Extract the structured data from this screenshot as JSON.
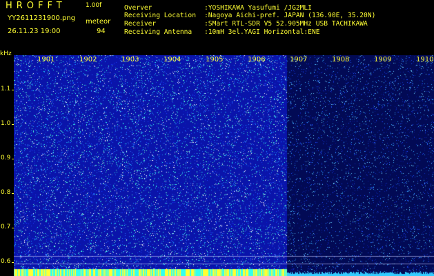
{
  "header": {
    "logo": "HROFFT",
    "version": "1.00f",
    "filename": "YY2611231900.png",
    "datetime": "26.11.23 19:00",
    "meteor_label": "meteor",
    "meteor_count": "94"
  },
  "info": [
    {
      "key": "Overver",
      "value": ":YOSHIKAWA Yasufumi /JG2MLI"
    },
    {
      "key": "Receiving Location",
      "value": ":Nagoya Aichi-pref. JAPAN (136.90E, 35.20N)"
    },
    {
      "key": "Receiver",
      "value": ":SMart RTL-SDR V5 52.905MHz USB TACHIKAWA"
    },
    {
      "key": "Receiving Antenna",
      "value": ":10mH 3el.YAGI Horizontal:ENE"
    }
  ],
  "axis": {
    "unit": "kHz",
    "freq_ticks": [
      "1.1",
      "1.0",
      "0.9",
      "0.8",
      "0.7",
      "0.6"
    ],
    "freq_values": [
      1.1,
      1.0,
      0.9,
      0.8,
      0.7,
      0.6
    ],
    "time_ticks": [
      "1901",
      "1902",
      "1903",
      "1904",
      "1905",
      "1906",
      "1907",
      "1908",
      "1909",
      "1910"
    ],
    "freq_range": [
      0.56,
      1.2
    ]
  },
  "colors": {
    "background": "#000000",
    "text": "#ffff33",
    "noise_dense": "#0a14aa",
    "noise_sparse": "#020a55",
    "highlight": "#33ffee"
  }
}
